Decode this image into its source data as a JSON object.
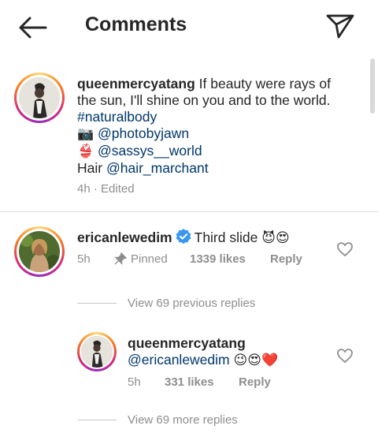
{
  "header": {
    "title": "Comments"
  },
  "caption": {
    "username": "queenmercyatang",
    "text_line1": "If beauty were rays of",
    "text_line2": "the sun, I'll shine on you and to the world.",
    "hashtag": "#naturalbody",
    "camera_emoji": "📷",
    "photographer": "@photobyjawn",
    "bikini_emoji": "👙",
    "stylist": "@sassys__world",
    "hair_label": "Hair",
    "hair_handle": "@hair_marchant",
    "time": "4h",
    "edited": "· Edited"
  },
  "comment": {
    "username": "ericanlewedim",
    "text": "Third slide",
    "emojis": "😈😍",
    "time": "5h",
    "pinned": "Pinned",
    "likes": "1339 likes",
    "reply": "Reply",
    "view_previous": "View 69 previous replies"
  },
  "reply": {
    "username": "queenmercyatang",
    "mention": "@ericanlewedim",
    "emojis": "😉😍❤️",
    "time": "5h",
    "likes": "331 likes",
    "reply": "Reply",
    "view_more": "View 69 more replies"
  },
  "colors": {
    "link": "#00376b",
    "secondary_text": "#8e8e8e",
    "verified": "#3897f0"
  }
}
